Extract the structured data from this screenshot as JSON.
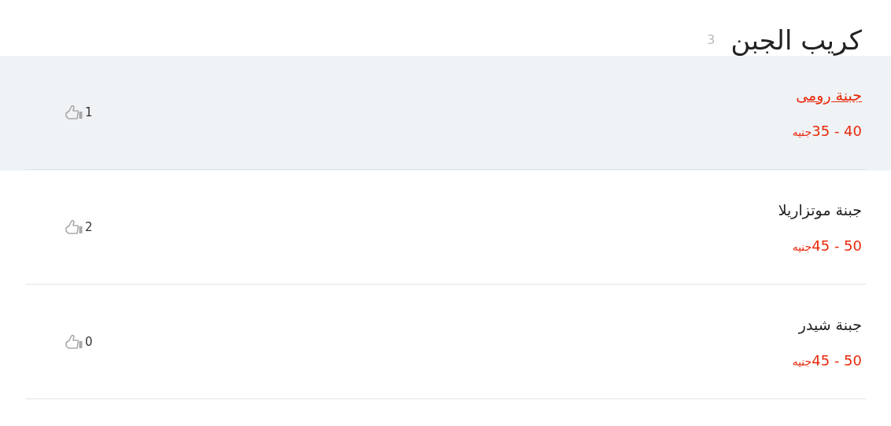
{
  "title": "كريب الجبن",
  "count": "3",
  "items": [
    {
      "name": "جبنة رومى",
      "price": "35 - 40",
      "currency": "جنيه",
      "likes": "1",
      "selected": true
    },
    {
      "name": "جبنة موتزاريلا",
      "price": "45 - 50",
      "currency": "جنيه",
      "likes": "2",
      "selected": false
    },
    {
      "name": "جبنة شيدر",
      "price": "45 - 50",
      "currency": "جنيه",
      "likes": "0",
      "selected": false
    }
  ]
}
